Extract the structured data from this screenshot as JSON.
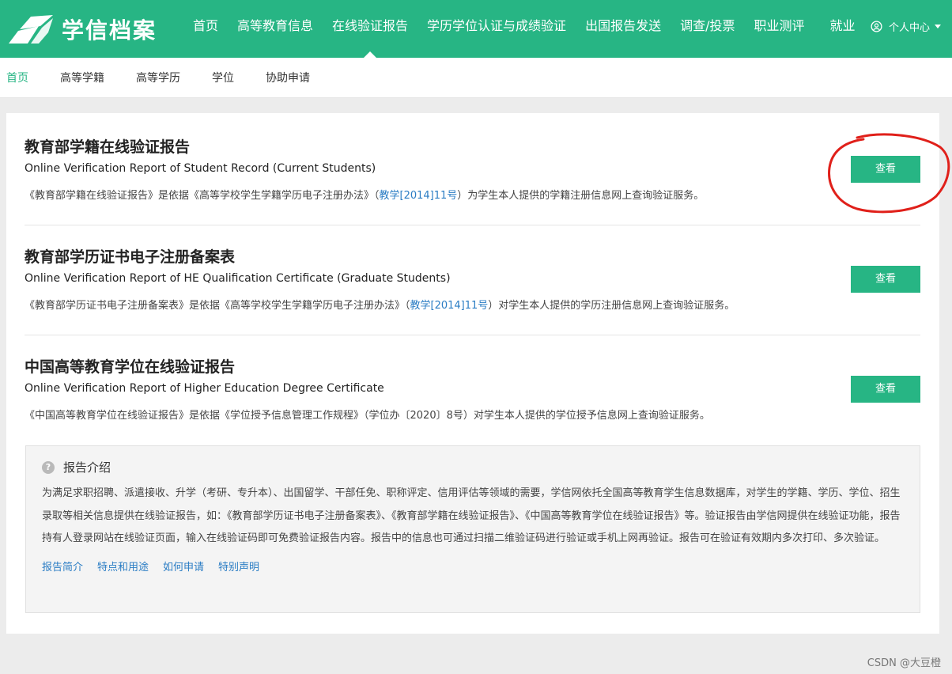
{
  "header": {
    "logo_text": "学信档案",
    "nav": [
      "首页",
      "高等教育信息",
      "在线验证报告",
      "学历学位认证与成绩验证",
      "出国报告发送",
      "调查/投票",
      "职业测评",
      "就业"
    ],
    "user_label": "个人中心",
    "accent": "#27b584"
  },
  "subnav": [
    "首页",
    "高等学籍",
    "高等学历",
    "学位",
    "协助申请"
  ],
  "reports": [
    {
      "title": "教育部学籍在线验证报告",
      "subtitle": "Online Verification Report of Student Record (Current Students)",
      "desc_pre": "《教育部学籍在线验证报告》是依据《高等学校学生学籍学历电子注册办法》（",
      "desc_link": "教学[2014]11号",
      "desc_post": "）为学生本人提供的学籍注册信息网上查询验证服务。",
      "button": "查看"
    },
    {
      "title": "教育部学历证书电子注册备案表",
      "subtitle": "Online Verification Report of HE Qualification Certificate (Graduate Students)",
      "desc_pre": "《教育部学历证书电子注册备案表》是依据《高等学校学生学籍学历电子注册办法》（",
      "desc_link": "教学[2014]11号",
      "desc_post": "）对学生本人提供的学历注册信息网上查询验证服务。",
      "button": "查看"
    },
    {
      "title": "中国高等教育学位在线验证报告",
      "subtitle": "Online Verification Report of Higher Education Degree Certificate",
      "desc_pre": "《中国高等教育学位在线验证报告》是依据《学位授予信息管理工作规程》（学位办〔2020〕8号）对学生本人提供的学位授予信息网上查询验证服务。",
      "desc_link": "",
      "desc_post": "",
      "button": "查看"
    }
  ],
  "intro": {
    "title": "报告介绍",
    "body": "为满足求职招聘、派遣接收、升学（考研、专升本）、出国留学、干部任免、职称评定、信用评估等领域的需要，学信网依托全国高等教育学生信息数据库，对学生的学籍、学历、学位、招生录取等相关信息提供在线验证报告，如：《教育部学历证书电子注册备案表》、《教育部学籍在线验证报告》、《中国高等教育学位在线验证报告》等。验证报告由学信网提供在线验证功能，报告持有人登录网站在线验证页面，输入在线验证码即可免费验证报告内容。报告中的信息也可通过扫描二维验证码进行验证或手机上网再验证。报告可在验证有效期内多次打印、多次验证。",
    "links": [
      "报告简介",
      "特点和用途",
      "如何申请",
      "特别声明"
    ]
  },
  "watermark": "CSDN @大豆橙",
  "annotation_color": "#e0201a"
}
